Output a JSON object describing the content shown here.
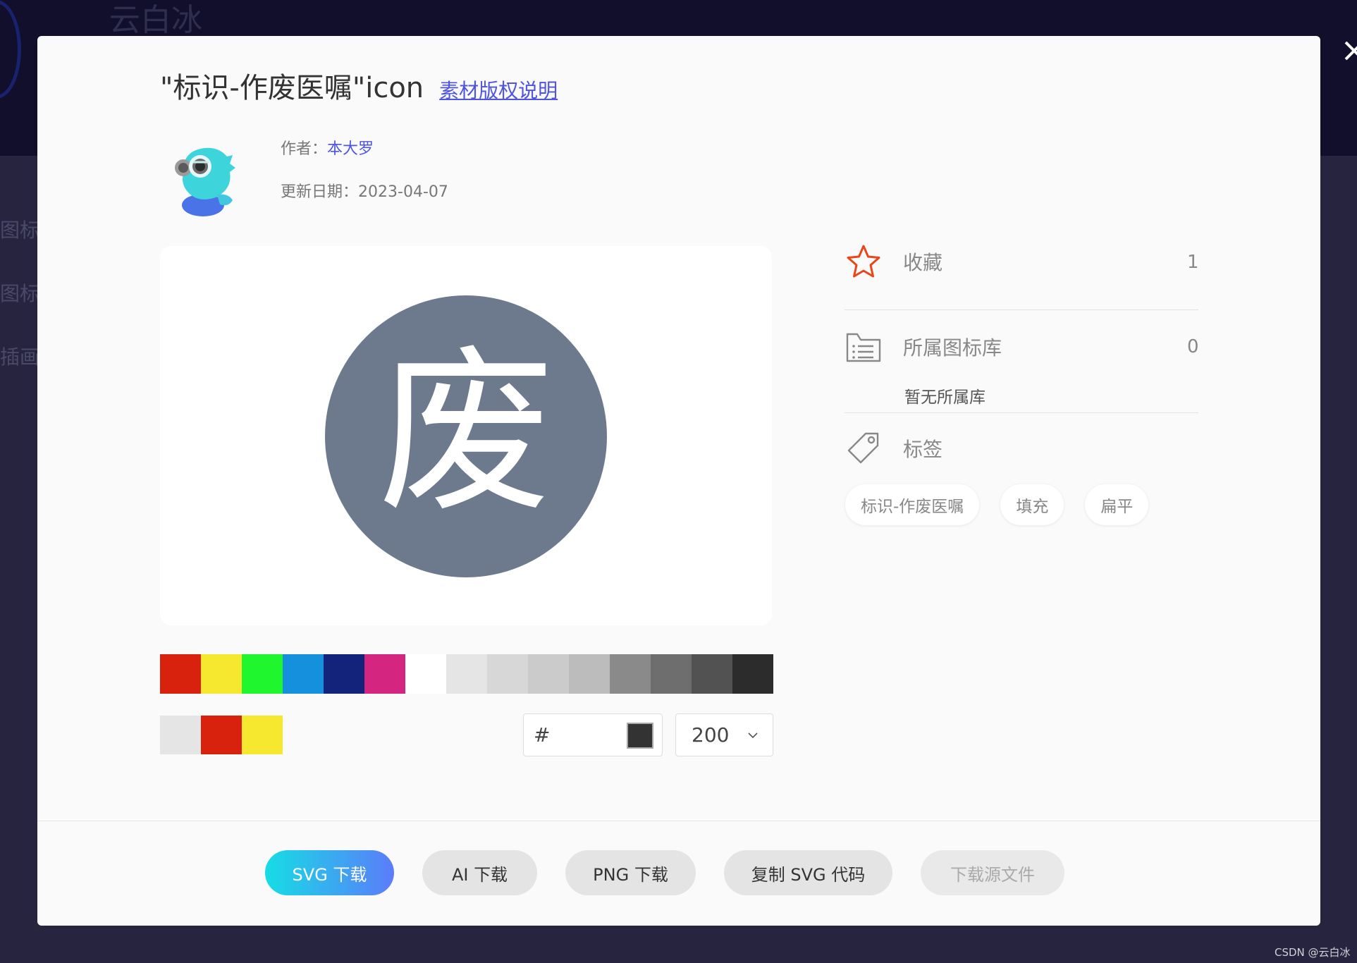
{
  "background": {
    "brand": "云白冰",
    "nav": [
      "图标",
      "图标库",
      "插画库"
    ]
  },
  "modal": {
    "title": "\"标识-作废医嘱\"icon",
    "copyright_link": "素材版权说明",
    "author_label": "作者：",
    "author_name": "本大罗",
    "date_label": "更新日期：",
    "date_value": "2023-04-07",
    "preview_char": "废",
    "preview_color": "#6d7a8d"
  },
  "palette": {
    "colors": [
      "#d9220e",
      "#f5e82e",
      "#1ff62d",
      "#1590dc",
      "#13227b",
      "#d42581",
      "#ffffff",
      "#e5e5e5",
      "#d7d7d7",
      "#cbcbcb",
      "#bcbcbc",
      "#8a8a8a",
      "#6e6e6e",
      "#525252",
      "#2c2c2c"
    ],
    "recent": [
      "#e5e5e5",
      "#d9220e",
      "#f5e82e"
    ]
  },
  "controls": {
    "hash": "#",
    "hex_value": "",
    "current_color": "#333333",
    "size_value": "200"
  },
  "info": {
    "favorite_label": "收藏",
    "favorite_count": "1",
    "library_label": "所属图标库",
    "library_count": "0",
    "no_library": "暂无所属库",
    "tags_label": "标签",
    "tags": [
      "标识-作废医嘱",
      "填充",
      "扁平"
    ]
  },
  "footer": {
    "svg_download": "SVG 下载",
    "ai_download": "AI 下载",
    "png_download": "PNG 下载",
    "copy_svg": "复制 SVG 代码",
    "source_download": "下载源文件"
  },
  "watermark": "CSDN @云白冰"
}
